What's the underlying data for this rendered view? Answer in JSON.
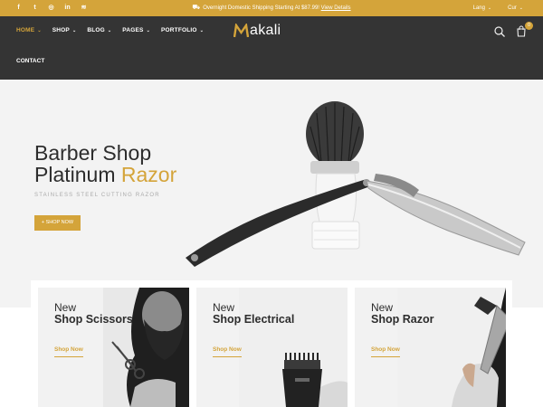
{
  "topbar": {
    "social_icons": [
      "facebook-icon",
      "twitter-icon",
      "instagram-icon",
      "linkedin-icon",
      "rss-icon"
    ],
    "social_glyphs": [
      "f",
      "t",
      "◎",
      "in",
      "≋"
    ],
    "notice_text": "Overnight Domestic Shipping Starting At $87.99!",
    "notice_link": "View Details",
    "lang_label": "Lang",
    "cur_label": "Cur"
  },
  "nav": {
    "items": [
      {
        "label": "HOME",
        "active": true
      },
      {
        "label": "SHOP",
        "active": false
      },
      {
        "label": "BLOG",
        "active": false
      },
      {
        "label": "PAGES",
        "active": false
      },
      {
        "label": "PORTFOLIO",
        "active": false
      }
    ],
    "contact": "CONTACT"
  },
  "logo": {
    "text": "akali",
    "accent_color": "#d4a43a"
  },
  "header": {
    "cart_count": "0",
    "icons": [
      "search-icon",
      "cart-icon"
    ]
  },
  "hero": {
    "title_line1": "Barber Shop",
    "title_line2_prefix": "Platinum ",
    "title_line2_accent": "Razor",
    "subtitle": "STAINLESS STEEL CUTTING RAZOR",
    "button_label": "+ SHOP NOW"
  },
  "cards": [
    {
      "new": "New",
      "category": "Shop Scissors",
      "link": "Shop Now"
    },
    {
      "new": "New",
      "category": "Shop Electrical",
      "link": "Shop Now"
    },
    {
      "new": "New",
      "category": "Shop Razor",
      "link": "Shop Now"
    }
  ],
  "colors": {
    "accent": "#d4a43a",
    "header_bg": "#343434",
    "hero_bg": "#f3f3f3"
  }
}
